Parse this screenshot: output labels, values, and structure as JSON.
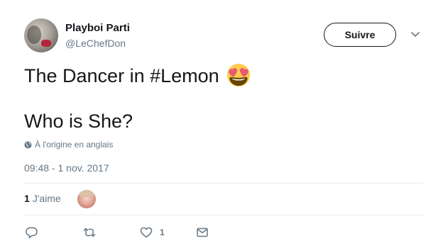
{
  "author": {
    "name": "Playboi Parti",
    "handle": "@LeChefDon"
  },
  "header": {
    "follow_label": "Suivre",
    "caret_icon": "chevron-down-icon"
  },
  "tweet": {
    "line1_before": "The Dancer in ",
    "hashtag": "#Lemon",
    "emoji": "smiling-face-with-heart-eyes",
    "line2": "Who is She?",
    "translation_note": "À l'origine en anglais",
    "timestamp": "09:48 - 1 nov. 2017"
  },
  "stats": {
    "likes_count": "1",
    "likes_label": "J'aime"
  },
  "actions": {
    "reply_icon": "reply-icon",
    "retweet_icon": "retweet-icon",
    "like_icon": "heart-icon",
    "like_count": "1",
    "dm_icon": "envelope-icon"
  },
  "colors": {
    "text": "#14171a",
    "secondary": "#657786",
    "divider": "#e6ecf0"
  }
}
